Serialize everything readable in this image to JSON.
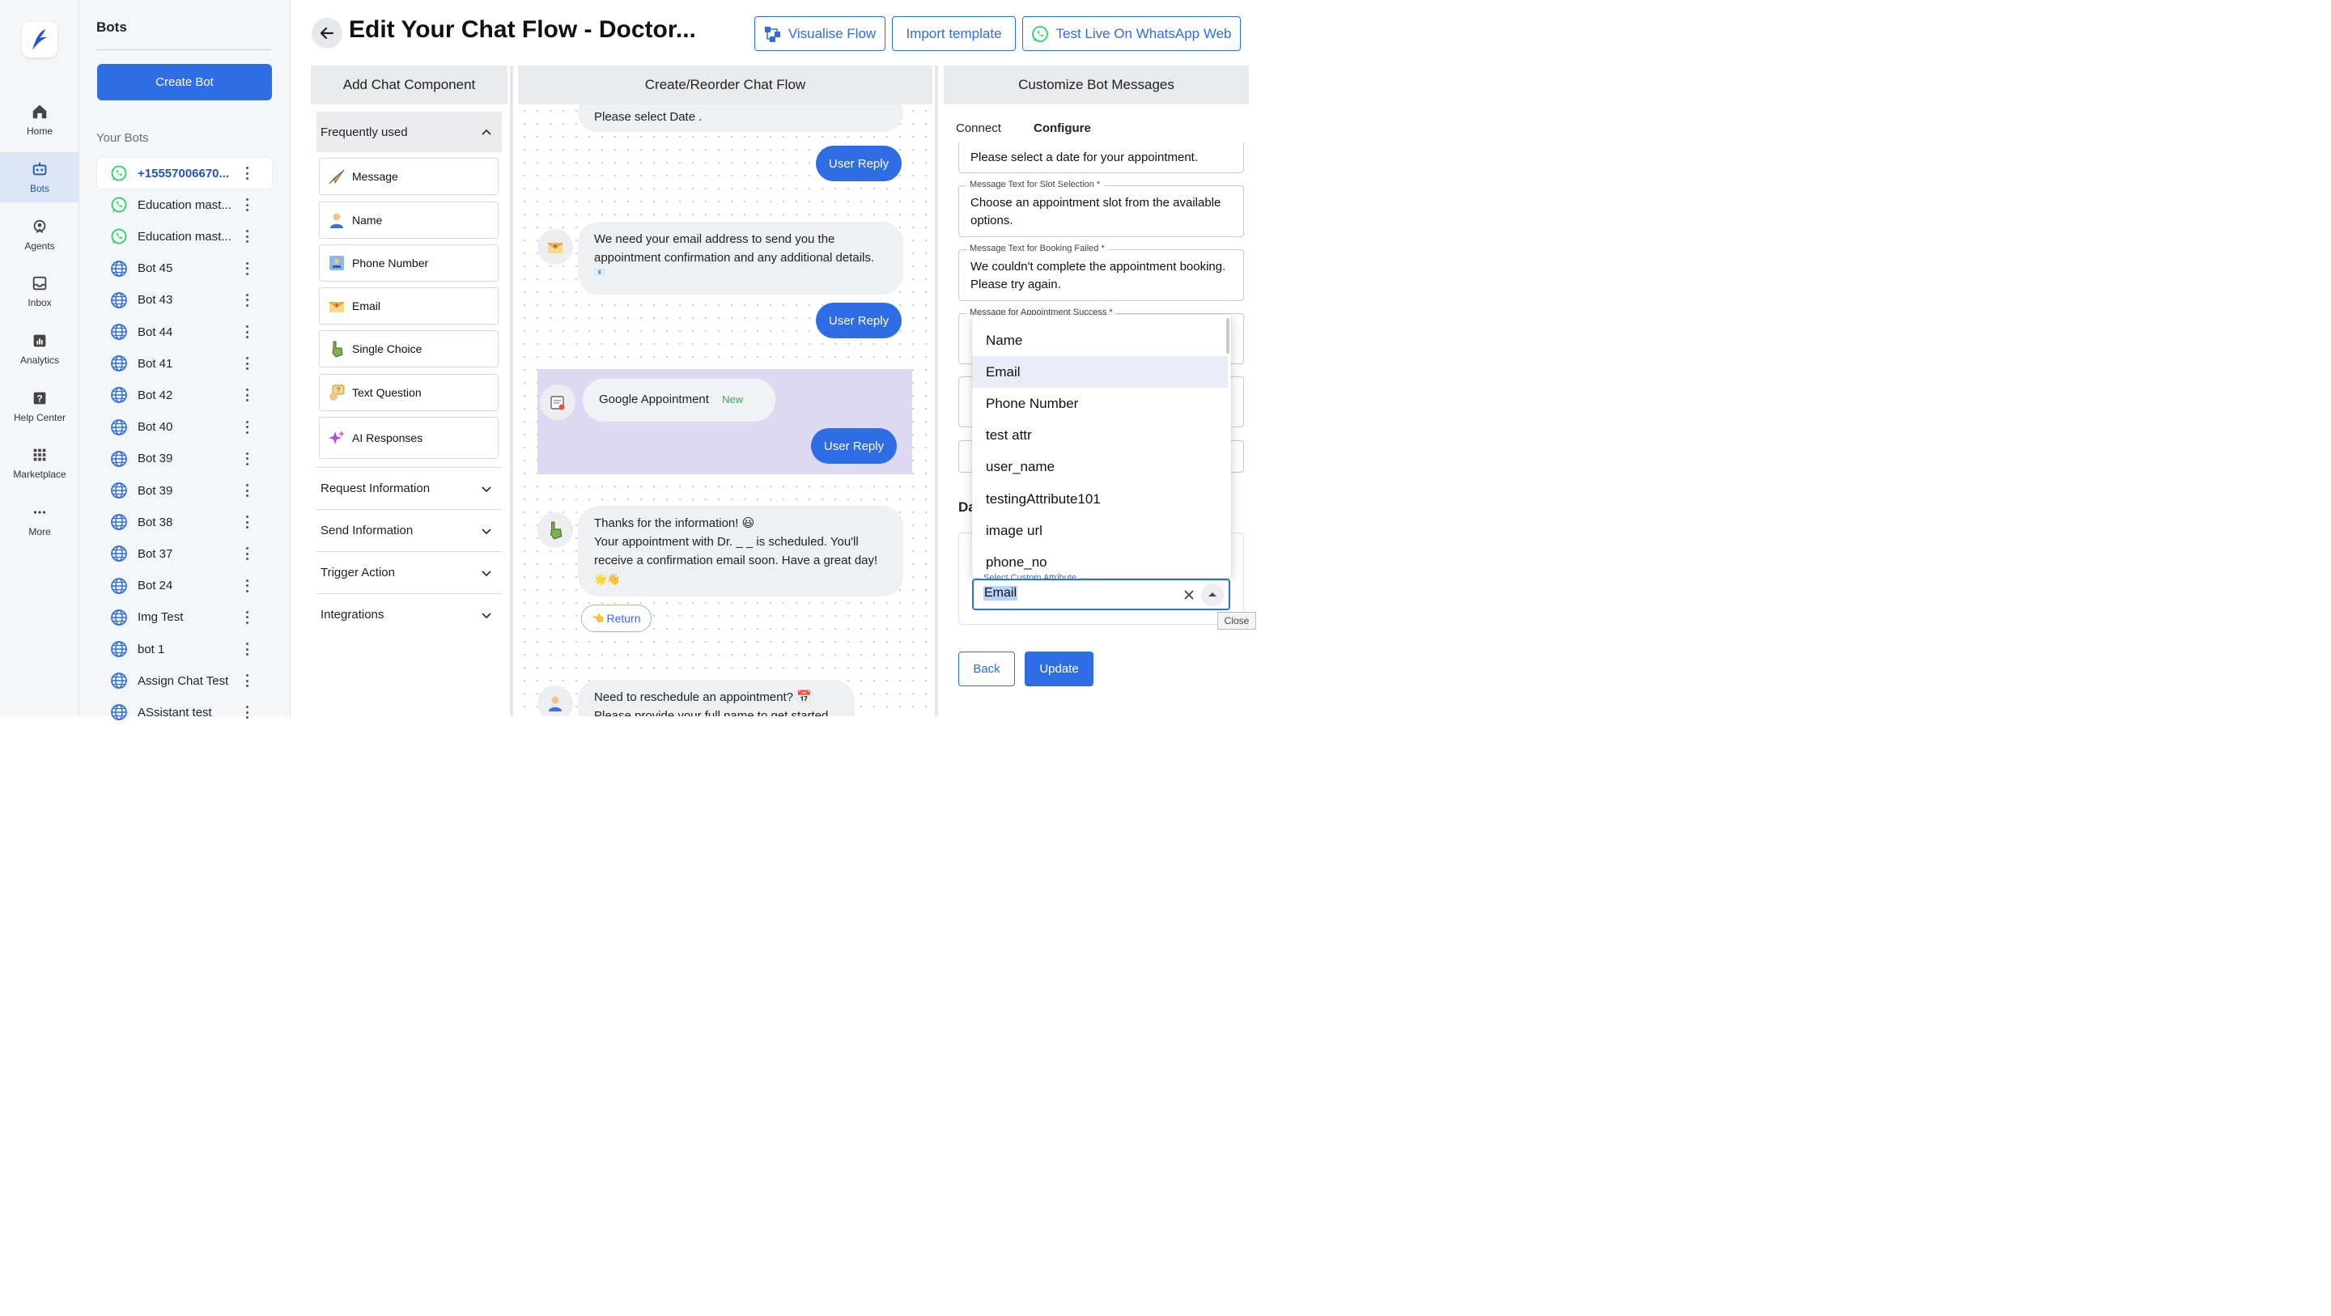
{
  "nav": {
    "items": [
      {
        "label": "Home",
        "icon": "home-icon"
      },
      {
        "label": "Bots",
        "icon": "bot-icon"
      },
      {
        "label": "Agents",
        "icon": "agent-icon"
      },
      {
        "label": "Inbox",
        "icon": "inbox-icon"
      },
      {
        "label": "Analytics",
        "icon": "analytics-icon"
      },
      {
        "label": "Help Center",
        "icon": "help-icon"
      },
      {
        "label": "Marketplace",
        "icon": "grid-icon"
      },
      {
        "label": "More",
        "icon": "more-icon"
      }
    ],
    "active": "Bots"
  },
  "bots": {
    "title": "Bots",
    "create_label": "Create Bot",
    "section_label": "Your Bots",
    "items": [
      {
        "name": "+15557006670...",
        "type": "whatsapp"
      },
      {
        "name": "Education mast...",
        "type": "whatsapp"
      },
      {
        "name": "Education mast...",
        "type": "whatsapp"
      },
      {
        "name": "Bot 45",
        "type": "web"
      },
      {
        "name": "Bot 43",
        "type": "web"
      },
      {
        "name": "Bot 44",
        "type": "web"
      },
      {
        "name": "Bot 41",
        "type": "web"
      },
      {
        "name": "Bot 42",
        "type": "web"
      },
      {
        "name": "Bot 40",
        "type": "web"
      },
      {
        "name": "Bot 39",
        "type": "web"
      },
      {
        "name": "Bot 39",
        "type": "web"
      },
      {
        "name": "Bot 38",
        "type": "web"
      },
      {
        "name": "Bot 37",
        "type": "web"
      },
      {
        "name": "Bot 24",
        "type": "web"
      },
      {
        "name": "Img Test",
        "type": "web"
      },
      {
        "name": "bot 1",
        "type": "web"
      },
      {
        "name": "Assign Chat Test",
        "type": "web"
      },
      {
        "name": "ASsistant test",
        "type": "web"
      }
    ]
  },
  "header": {
    "title": "Edit Your Chat Flow - Doctor...",
    "visualise_label": "Visualise Flow",
    "import_label": "Import template",
    "test_label": "Test Live On WhatsApp Web"
  },
  "components": {
    "heading": "Add Chat Component",
    "frequent_label": "Frequently used",
    "items": [
      {
        "label": "Message",
        "icon": "paper-plane-icon"
      },
      {
        "label": "Name",
        "icon": "person-icon"
      },
      {
        "label": "Phone Number",
        "icon": "contact-card-icon"
      },
      {
        "label": "Email",
        "icon": "envelope-icon"
      },
      {
        "label": "Single Choice",
        "icon": "pointing-hand-icon"
      },
      {
        "label": "Text Question",
        "icon": "speech-question-icon"
      },
      {
        "label": "AI Responses",
        "icon": "sparkles-icon"
      }
    ],
    "sections": [
      "Request Information",
      "Send Information",
      "Trigger Action",
      "Integrations"
    ]
  },
  "flow": {
    "heading": "Create/Reorder Chat Flow",
    "select_date": "Please select Date .",
    "user_reply": "User Reply",
    "email_msg_1": "We need your email address to send you the",
    "email_msg_2": "appointment confirmation and any additional details.",
    "email_msg_3": "📧",
    "google_label": "Google Appointment",
    "new_badge": "New",
    "thanks_1": "Thanks for the information! 😃",
    "thanks_2": "Your appointment with Dr. _ _ is scheduled. You'll",
    "thanks_3": "receive a confirmation email soon. Have a great day!",
    "thanks_4": "🌟👋",
    "return_label": "Return",
    "return_emoji": "👈",
    "resched_1": "Need to reschedule an appointment? 📅",
    "resched_2": "Please provide your full name to get started."
  },
  "customize": {
    "heading": "Customize Bot Messages",
    "tabs": [
      "Connect",
      "Configure"
    ],
    "active_tab": "Configure",
    "date_text": "Please select a date for your appointment.",
    "slot_label": "Message Text for Slot Selection *",
    "slot_text": "Choose an appointment slot from the available options.",
    "failed_label": "Message Text for Booking Failed *",
    "failed_text": "We couldn't complete the appointment booking. Please try again.",
    "success_label": "Message for Appointment Success *",
    "partial_heading": "Da",
    "dropdown_options": [
      "Name",
      "Email",
      "Phone Number",
      "test attr",
      "user_name",
      "testingAttribute101",
      "image url",
      "phone_no"
    ],
    "highlighted_option": "Email",
    "select_label": "Select Custom Attribute",
    "select_value": "Email",
    "tooltip": "Close",
    "back_label": "Back",
    "update_label": "Update"
  },
  "colors": {
    "accent": "#2f6de5",
    "google_block": "#ddd9f2",
    "whatsapp": "#25d366"
  }
}
